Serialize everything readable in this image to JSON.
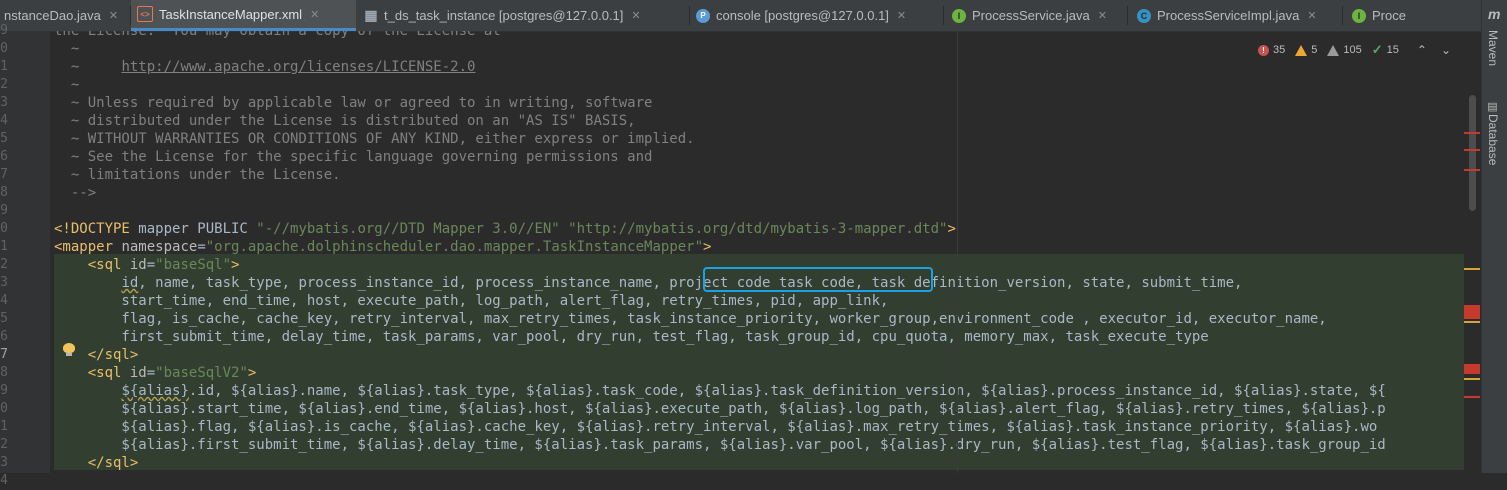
{
  "tabs": [
    {
      "label": "nstanceDao.java",
      "icon": "java-class-icon",
      "icon_glyph": "",
      "icon_color": "",
      "active": false,
      "closable": true
    },
    {
      "label": "TaskInstanceMapper.xml",
      "icon": "xml-file-icon",
      "icon_glyph": "<>",
      "icon_color": "#e8784d",
      "active": true,
      "closable": true
    },
    {
      "label": "t_ds_task_instance [postgres@127.0.0.1]",
      "icon": "table-icon",
      "icon_glyph": "▦",
      "icon_color": "#9aa7b0",
      "active": false,
      "closable": true
    },
    {
      "label": "console [postgres@127.0.0.1]",
      "icon": "postgresql-icon",
      "icon_glyph": "🐘",
      "icon_color": "#5b9bd5",
      "active": false,
      "closable": true
    },
    {
      "label": "ProcessService.java",
      "icon": "interface-icon",
      "icon_glyph": "I",
      "icon_color": "#6db33f",
      "active": false,
      "closable": true
    },
    {
      "label": "ProcessServiceImpl.java",
      "icon": "class-icon",
      "icon_glyph": "C",
      "icon_color": "#3592c4",
      "active": false,
      "closable": true
    },
    {
      "label": "Proce",
      "icon": "interface-icon",
      "icon_glyph": "I",
      "icon_color": "#6db33f",
      "active": false,
      "closable": false
    }
  ],
  "right_panel": {
    "maven_label": "Maven",
    "database_label": "Database",
    "maven_icon": "m"
  },
  "inspections": {
    "errors": "35",
    "warnings": "5",
    "weak_warnings": "105",
    "ok": "15"
  },
  "gutter_numbers": [
    "9",
    "0",
    "1",
    "2",
    "3",
    "4",
    "5",
    "6",
    "7",
    "8",
    "9",
    "0",
    "1",
    "2",
    "3",
    "4",
    "5",
    "6",
    "7",
    "8",
    "9",
    "0",
    "1",
    "2",
    "3",
    "4"
  ],
  "current_line_index": 18,
  "code": {
    "l00": "the License.  You may obtain a copy of the License at",
    "l01_tilde": "  ~",
    "l02_tilde": "  ~     ",
    "l02_url": "http://www.apache.org/licenses/LICENSE-2.0",
    "l03_tilde": "  ~",
    "l04": "  ~ Unless required by applicable law or agreed to in writing, software",
    "l05": "  ~ distributed under the License is distributed on an \"AS IS\" BASIS,",
    "l06": "  ~ WITHOUT WARRANTIES OR CONDITIONS OF ANY KIND, either express or implied.",
    "l07": "  ~ See the License for the specific language governing permissions and",
    "l08": "  ~ limitations under the License.",
    "l09": "  -->",
    "doctype_open": "<!DOCTYPE",
    "doctype_mid": " mapper PUBLIC ",
    "doctype_pub": "\"-//mybatis.org//DTD Mapper 3.0//EN\"",
    "doctype_sys": " \"http://mybatis.org/dtd/mybatis-3-mapper.dtd\"",
    "doctype_close": ">",
    "mapper_open": "<mapper",
    "mapper_attr": " namespace",
    "mapper_eq": "=",
    "mapper_val": "\"org.apache.dolphinscheduler.dao.mapper.TaskInstanceMapper\"",
    "mapper_close": ">",
    "sql1_open": "    <sql",
    "sql1_attr": " id",
    "sql1_eq": "=",
    "sql1_val": "\"baseSql\"",
    "sql1_close": ">",
    "s1a_indent": "        ",
    "s1a_id": "id",
    "s1a_rest": ", name, task_type, process_instance_id, process_instance_name, project_code task_code, task_definition_version, state, submit_time,",
    "s1b": "        start_time, end_time, host, execute_path, log_path, alert_flag, retry_times, pid, app_link,",
    "s1c": "        flag, is_cache, cache_key, retry_interval, max_retry_times, task_instance_priority, worker_group,environment_code , executor_id, executor_name,",
    "s1d": "        first_submit_time, delay_time, task_params, var_pool, dry_run, test_flag, task_group_id, cpu_quota, memory_max, task_execute_type",
    "sql1_end": "    </sql>",
    "sql2_open": "    <sql",
    "sql2_attr": " id",
    "sql2_eq": "=",
    "sql2_val": "\"baseSqlV2\"",
    "sql2_close": ">",
    "s2a_indent": "        ",
    "s2a_alias": "${alias}",
    "s2a_rest": ".id, ${alias}.name, ${alias}.task_type, ${alias}.task_code, ${alias}.task_definition_version, ${alias}.process_instance_id, ${alias}.state, ${",
    "s2b": "        ${alias}.start_time, ${alias}.end_time, ${alias}.host, ${alias}.execute_path, ${alias}.log_path, ${alias}.alert_flag, ${alias}.retry_times, ${alias}.p",
    "s2c": "        ${alias}.flag, ${alias}.is_cache, ${alias}.cache_key, ${alias}.retry_interval, ${alias}.max_retry_times, ${alias}.task_instance_priority, ${alias}.wo",
    "s2d": "        ${alias}.first_submit_time, ${alias}.delay_time, ${alias}.task_params, ${alias}.var_pool, ${alias}.dry_run, ${alias}.test_flag, ${alias}.task_group_id",
    "sql2_end": "    </sql>"
  },
  "colors": {
    "accent_highlight_box": "#1da1e6",
    "error_mark": "#c53a2c",
    "warning_mark": "#d9a430"
  }
}
